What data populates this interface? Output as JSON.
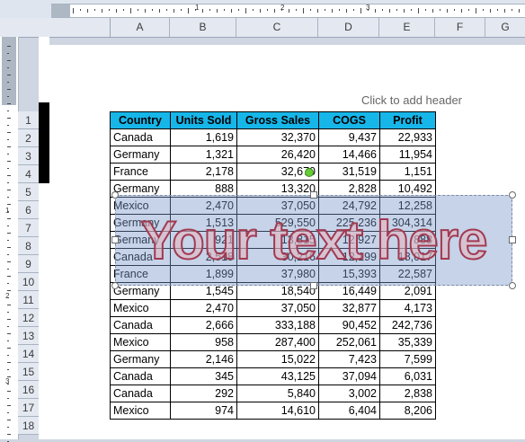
{
  "ruler": {
    "numbers": [
      "1",
      "2",
      "3"
    ]
  },
  "vruler": {
    "numbers": [
      "1",
      "2",
      "3"
    ]
  },
  "columns": [
    "A",
    "B",
    "C",
    "D",
    "E",
    "F",
    "G"
  ],
  "rows": [
    "1",
    "2",
    "3",
    "4",
    "5",
    "6",
    "7",
    "8",
    "9",
    "10",
    "11",
    "12",
    "13",
    "14",
    "15",
    "16",
    "17",
    "18"
  ],
  "page": {
    "header_hint": "Click to add header"
  },
  "table": {
    "headers": [
      "Country",
      "Units Sold",
      "Gross Sales",
      "COGS",
      "Profit"
    ],
    "rows": [
      [
        "Canada",
        "1,619",
        "32,370",
        "9,437",
        "22,933"
      ],
      [
        "Germany",
        "1,321",
        "26,420",
        "14,466",
        "11,954"
      ],
      [
        "France",
        "2,178",
        "32,670",
        "31,519",
        "1,151"
      ],
      [
        "Germany",
        "888",
        "13,320",
        "2,828",
        "10,492"
      ],
      [
        "Mexico",
        "2,470",
        "37,050",
        "24,792",
        "12,258"
      ],
      [
        "Germany",
        "1,513",
        "529,550",
        "225,236",
        "304,314"
      ],
      [
        "Germany",
        "921",
        "13,815",
        "12,927",
        "888"
      ],
      [
        "Canada",
        "2,518",
        "30,216",
        "12,199",
        "18,017"
      ],
      [
        "France",
        "1,899",
        "37,980",
        "15,393",
        "22,587"
      ],
      [
        "Germany",
        "1,545",
        "18,540",
        "16,449",
        "2,091"
      ],
      [
        "Mexico",
        "2,470",
        "37,050",
        "32,877",
        "4,173"
      ],
      [
        "Canada",
        "2,666",
        "333,188",
        "90,452",
        "242,736"
      ],
      [
        "Mexico",
        "958",
        "287,400",
        "252,061",
        "35,339"
      ],
      [
        "Germany",
        "2,146",
        "15,022",
        "7,423",
        "7,599"
      ],
      [
        "Canada",
        "345",
        "43,125",
        "37,094",
        "6,031"
      ],
      [
        "Canada",
        "292",
        "5,840",
        "3,002",
        "2,838"
      ],
      [
        "Mexico",
        "974",
        "14,610",
        "6,404",
        "8,206"
      ]
    ]
  },
  "wordart": {
    "text": "Your text here"
  }
}
